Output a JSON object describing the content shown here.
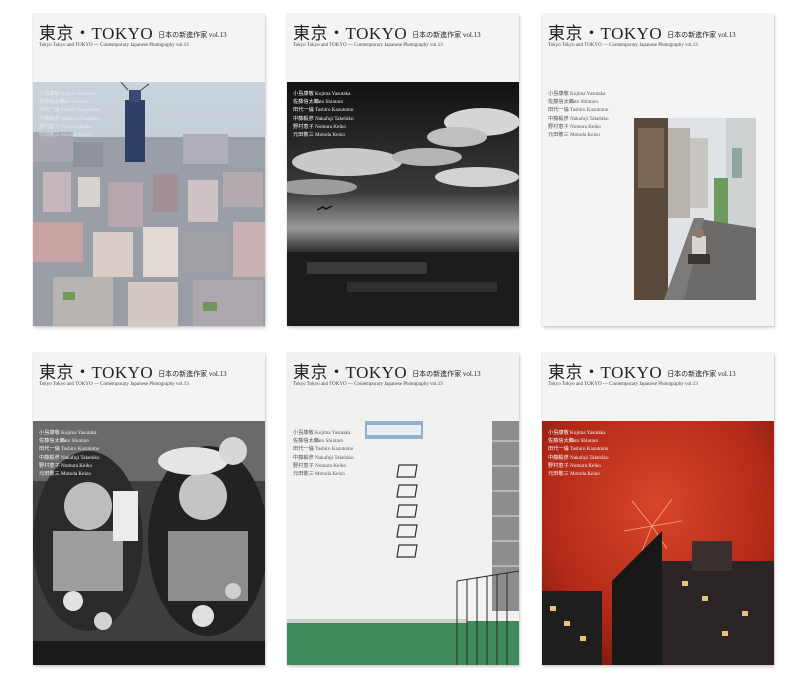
{
  "cover": {
    "title": "東京・TOKYO",
    "series": "日本の新進作家 vol.13",
    "subtitle": "Tokyo Tokyo and TOKYO — Contemporary Japanese Photography vol.13"
  },
  "artists": [
    {
      "jp": "小島康敬",
      "en": "Kojima Yasutaka"
    },
    {
      "jp": "佐藤信太郎",
      "en": "Sato Shintaro"
    },
    {
      "jp": "田代一倫",
      "en": "Tashiro Kazutomo"
    },
    {
      "jp": "中藤毅彦",
      "en": "Nakafuji Takehiko"
    },
    {
      "jp": "野村恵子",
      "en": "Nomura Keiko"
    },
    {
      "jp": "元田敬三",
      "en": "Motoda Keizo"
    }
  ],
  "books": [
    {
      "name": "cover-city-tower",
      "photo": "color aerial city view with tower under construction"
    },
    {
      "name": "cover-monochrome-sky",
      "photo": "black and white sky over city"
    },
    {
      "name": "cover-street-alley",
      "photo": "man crouching in narrow street"
    },
    {
      "name": "cover-girls",
      "photo": "black and white two girls with accessories"
    },
    {
      "name": "cover-white-wall",
      "photo": "white wall with windows and green rooftop"
    },
    {
      "name": "cover-fireworks",
      "photo": "red fireworks over buildings at night"
    }
  ],
  "colors": {
    "cover_bg": "#f4f4f2",
    "sky_red": "#c8321e",
    "roof_green": "#3f8a5a"
  }
}
